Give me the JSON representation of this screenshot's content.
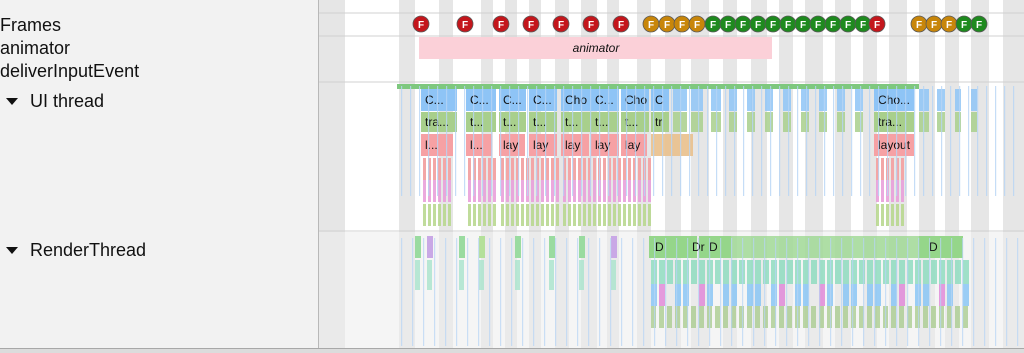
{
  "tracks": {
    "frames": "Frames",
    "animator": "animator",
    "deliver_input": "deliverInputEvent",
    "ui_thread": "UI thread",
    "render_thread": "RenderThread"
  },
  "frame_marker_letter": "F",
  "animator_slice_label": "animator",
  "ui_choreographer_labels": [
    "C...",
    "C...",
    "C...",
    "C...",
    "Cho",
    "C...",
    "Cho",
    "C",
    "Cho..."
  ],
  "ui_traversal_labels": [
    "tra...",
    "t...",
    "t...",
    "t...",
    "t...",
    "t...",
    "t...",
    "tr",
    "tra..."
  ],
  "ui_layout_labels": [
    "l...",
    "l...",
    "lay",
    "lay",
    "lay",
    "lay",
    "lay",
    "layout"
  ],
  "render_labels": [
    "D",
    "Dr",
    "D",
    "D"
  ],
  "colors": {
    "frame_red": "#c4161c",
    "frame_orange": "#c8860a",
    "frame_green": "#1e8a1e",
    "choreographer_blue": "#8ec4f6",
    "traversal_green": "#a8cf8c",
    "layout_pink": "#f6a1a4",
    "draw_green": "#95d68a",
    "animator_pink": "#fbd0d8",
    "stripe_gray": "#e3e3e3"
  }
}
